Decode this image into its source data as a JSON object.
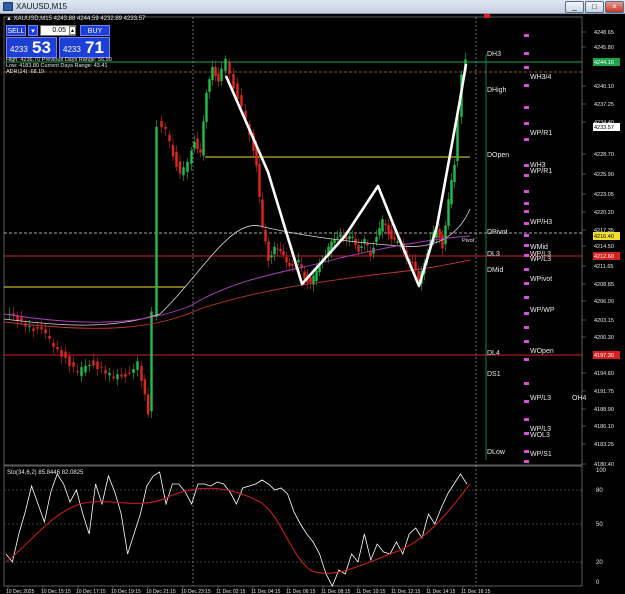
{
  "window": {
    "title": "XAUUSD,M15",
    "minimize": "_",
    "maximize": "□",
    "close": "×"
  },
  "chart_header": {
    "symbol_line": "▲ XAUUSD,M15  4243.88 4244.59 4232.89 4233.57"
  },
  "trade_panel": {
    "sell_label": "SELL",
    "buy_label": "BUY",
    "lot": "0.05",
    "sell_small": "4233",
    "sell_big": "53",
    "buy_small": "4233",
    "buy_big": "71"
  },
  "info": {
    "line1": "High: 4236.70    Previous Days Range: 56.90",
    "line2": "Low: 4183.80    Current Days Range: 43.41",
    "line3": "ADR(14): 68.19"
  },
  "price_axis": {
    "labels": [
      "4248.65",
      "4245.80",
      "4240.10",
      "4237.25",
      "4234.40",
      "4228.70",
      "4225.90",
      "4223.05",
      "4220.20",
      "4217.35",
      "4214.50",
      "4211.65",
      "4208.85",
      "4206.00",
      "4203.15",
      "4200.30",
      "4194.60",
      "4191.75",
      "4188.90",
      "4186.10",
      "4183.25",
      "4180.40"
    ],
    "badges": [
      {
        "text": "4244.16",
        "color": "#1fa34a"
      },
      {
        "text": "4233.57",
        "color": "#ffffff"
      },
      {
        "text": "4216.40",
        "color": "#f2e12c"
      },
      {
        "text": "4212.60",
        "color": "#d61f1f"
      },
      {
        "text": "4197.30",
        "color": "#d61f1f"
      }
    ]
  },
  "levels": {
    "dh3": "DH3",
    "dhigh": "DHigh",
    "dopen": "DOpen",
    "dpivot": "DPivot",
    "pivot": "Pivot",
    "dl3": "DL3",
    "dmid": "DMid",
    "dl4": "DL4",
    "ds1": "DS1",
    "dlow": "DLow",
    "wh34": "WH3/4",
    "wpr1": "WP/R1",
    "wh3": "WH3",
    "wpr1b": "WP/R1",
    "wph3": "WP/H3",
    "wmid": "WMid",
    "wpl3": "WP/L3",
    "wpl3b": "WP/L3",
    "wpivot": "WPivot",
    "wpwp": "WP/WP",
    "wopen": "WOpen",
    "wpl3c": "WP/L3",
    "oh4": "OH4",
    "wpl3d": "WP/L3",
    "wol3": "WOL3",
    "wps1": "WP/S1"
  },
  "oscillator": {
    "title": "Sto(34,6,2) 85.8446 82.0825",
    "labels": [
      "100",
      "80",
      "50",
      "20",
      "0"
    ]
  },
  "time_axis": {
    "labels": [
      "10 Dec 2025",
      "10 Dec 15:15",
      "10 Dec 17:15",
      "10 Dec 19:15",
      "10 Dec 21:15",
      "10 Dec 23:15",
      "11 Dec 02:15",
      "11 Dec 04:15",
      "11 Dec 06:15",
      "11 Dec 08:15",
      "11 Dec 10:15",
      "11 Dec 12:15",
      "11 Dec 14:15",
      "11 Dec 16:15"
    ]
  },
  "colors": {
    "bull": "#1fbf4a",
    "bear": "#e0261e",
    "stoch_main": "#ffffff",
    "stoch_signal": "#d81e1e",
    "pattern": "#ffffff",
    "yellow": "#f2e12c",
    "magenta": "#d84fd8"
  }
}
